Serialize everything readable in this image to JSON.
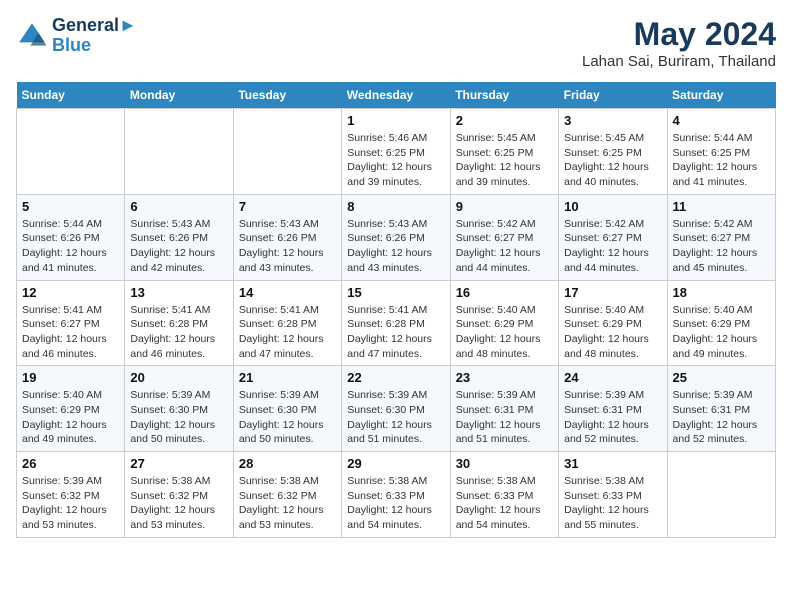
{
  "app": {
    "logo_line1": "General",
    "logo_line2": "Blue",
    "title": "May 2024",
    "subtitle": "Lahan Sai, Buriram, Thailand"
  },
  "calendar": {
    "headers": [
      "Sunday",
      "Monday",
      "Tuesday",
      "Wednesday",
      "Thursday",
      "Friday",
      "Saturday"
    ],
    "weeks": [
      [
        {
          "day": "",
          "info": ""
        },
        {
          "day": "",
          "info": ""
        },
        {
          "day": "",
          "info": ""
        },
        {
          "day": "1",
          "info": "Sunrise: 5:46 AM\nSunset: 6:25 PM\nDaylight: 12 hours\nand 39 minutes."
        },
        {
          "day": "2",
          "info": "Sunrise: 5:45 AM\nSunset: 6:25 PM\nDaylight: 12 hours\nand 39 minutes."
        },
        {
          "day": "3",
          "info": "Sunrise: 5:45 AM\nSunset: 6:25 PM\nDaylight: 12 hours\nand 40 minutes."
        },
        {
          "day": "4",
          "info": "Sunrise: 5:44 AM\nSunset: 6:25 PM\nDaylight: 12 hours\nand 41 minutes."
        }
      ],
      [
        {
          "day": "5",
          "info": "Sunrise: 5:44 AM\nSunset: 6:26 PM\nDaylight: 12 hours\nand 41 minutes."
        },
        {
          "day": "6",
          "info": "Sunrise: 5:43 AM\nSunset: 6:26 PM\nDaylight: 12 hours\nand 42 minutes."
        },
        {
          "day": "7",
          "info": "Sunrise: 5:43 AM\nSunset: 6:26 PM\nDaylight: 12 hours\nand 43 minutes."
        },
        {
          "day": "8",
          "info": "Sunrise: 5:43 AM\nSunset: 6:26 PM\nDaylight: 12 hours\nand 43 minutes."
        },
        {
          "day": "9",
          "info": "Sunrise: 5:42 AM\nSunset: 6:27 PM\nDaylight: 12 hours\nand 44 minutes."
        },
        {
          "day": "10",
          "info": "Sunrise: 5:42 AM\nSunset: 6:27 PM\nDaylight: 12 hours\nand 44 minutes."
        },
        {
          "day": "11",
          "info": "Sunrise: 5:42 AM\nSunset: 6:27 PM\nDaylight: 12 hours\nand 45 minutes."
        }
      ],
      [
        {
          "day": "12",
          "info": "Sunrise: 5:41 AM\nSunset: 6:27 PM\nDaylight: 12 hours\nand 46 minutes."
        },
        {
          "day": "13",
          "info": "Sunrise: 5:41 AM\nSunset: 6:28 PM\nDaylight: 12 hours\nand 46 minutes."
        },
        {
          "day": "14",
          "info": "Sunrise: 5:41 AM\nSunset: 6:28 PM\nDaylight: 12 hours\nand 47 minutes."
        },
        {
          "day": "15",
          "info": "Sunrise: 5:41 AM\nSunset: 6:28 PM\nDaylight: 12 hours\nand 47 minutes."
        },
        {
          "day": "16",
          "info": "Sunrise: 5:40 AM\nSunset: 6:29 PM\nDaylight: 12 hours\nand 48 minutes."
        },
        {
          "day": "17",
          "info": "Sunrise: 5:40 AM\nSunset: 6:29 PM\nDaylight: 12 hours\nand 48 minutes."
        },
        {
          "day": "18",
          "info": "Sunrise: 5:40 AM\nSunset: 6:29 PM\nDaylight: 12 hours\nand 49 minutes."
        }
      ],
      [
        {
          "day": "19",
          "info": "Sunrise: 5:40 AM\nSunset: 6:29 PM\nDaylight: 12 hours\nand 49 minutes."
        },
        {
          "day": "20",
          "info": "Sunrise: 5:39 AM\nSunset: 6:30 PM\nDaylight: 12 hours\nand 50 minutes."
        },
        {
          "day": "21",
          "info": "Sunrise: 5:39 AM\nSunset: 6:30 PM\nDaylight: 12 hours\nand 50 minutes."
        },
        {
          "day": "22",
          "info": "Sunrise: 5:39 AM\nSunset: 6:30 PM\nDaylight: 12 hours\nand 51 minutes."
        },
        {
          "day": "23",
          "info": "Sunrise: 5:39 AM\nSunset: 6:31 PM\nDaylight: 12 hours\nand 51 minutes."
        },
        {
          "day": "24",
          "info": "Sunrise: 5:39 AM\nSunset: 6:31 PM\nDaylight: 12 hours\nand 52 minutes."
        },
        {
          "day": "25",
          "info": "Sunrise: 5:39 AM\nSunset: 6:31 PM\nDaylight: 12 hours\nand 52 minutes."
        }
      ],
      [
        {
          "day": "26",
          "info": "Sunrise: 5:39 AM\nSunset: 6:32 PM\nDaylight: 12 hours\nand 53 minutes."
        },
        {
          "day": "27",
          "info": "Sunrise: 5:38 AM\nSunset: 6:32 PM\nDaylight: 12 hours\nand 53 minutes."
        },
        {
          "day": "28",
          "info": "Sunrise: 5:38 AM\nSunset: 6:32 PM\nDaylight: 12 hours\nand 53 minutes."
        },
        {
          "day": "29",
          "info": "Sunrise: 5:38 AM\nSunset: 6:33 PM\nDaylight: 12 hours\nand 54 minutes."
        },
        {
          "day": "30",
          "info": "Sunrise: 5:38 AM\nSunset: 6:33 PM\nDaylight: 12 hours\nand 54 minutes."
        },
        {
          "day": "31",
          "info": "Sunrise: 5:38 AM\nSunset: 6:33 PM\nDaylight: 12 hours\nand 55 minutes."
        },
        {
          "day": "",
          "info": ""
        }
      ]
    ]
  }
}
